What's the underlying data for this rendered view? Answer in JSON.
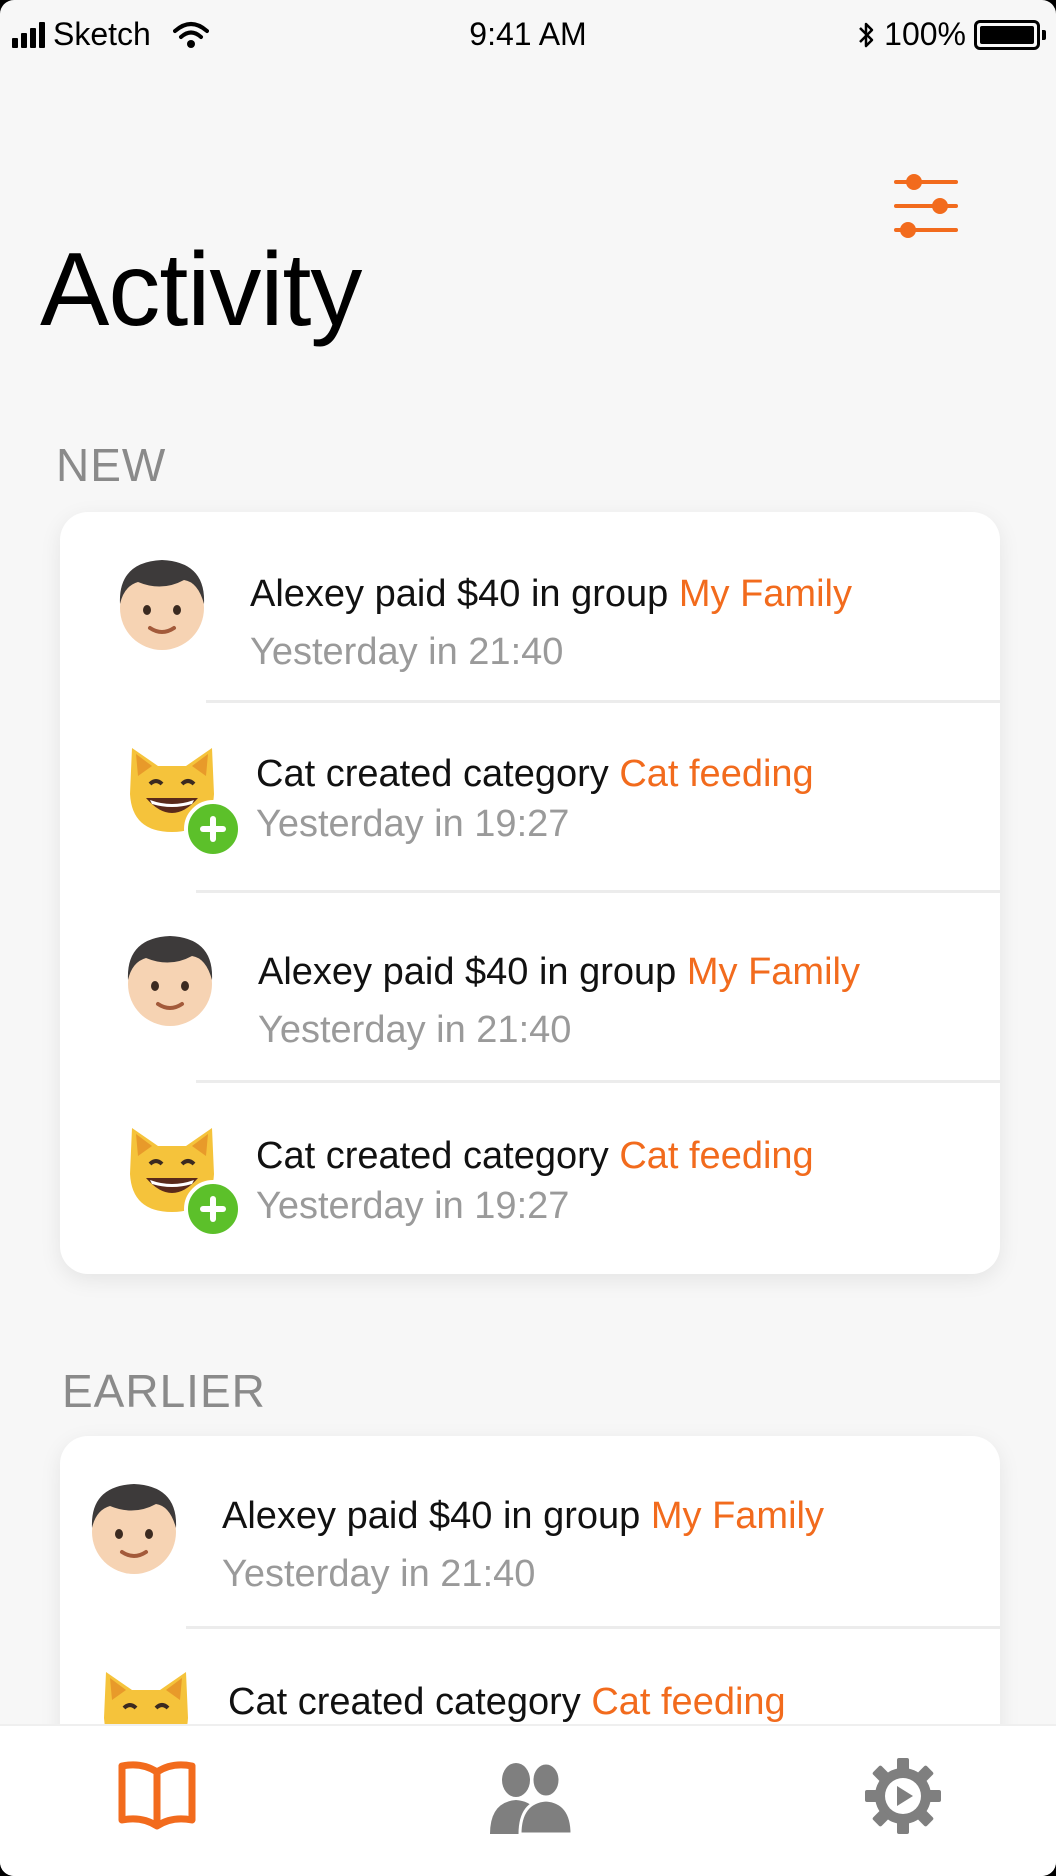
{
  "status_bar": {
    "carrier": "Sketch",
    "time": "9:41 AM",
    "battery": "100%",
    "battery_level": 1.0
  },
  "header": {
    "title": "Activity",
    "filter_icon": "sliders-icon"
  },
  "sections": [
    {
      "label": "NEW",
      "items": [
        {
          "actor_icon": "boy-face-emoji-icon",
          "text": "Alexey paid $40 in group ",
          "link": "My Family",
          "time": "Yesterday in 21:40"
        },
        {
          "actor_icon": "cat-face-emoji-icon",
          "badge_icon": "plus-circle-icon",
          "text": "Cat created category ",
          "link": "Cat feeding",
          "time": "Yesterday in 19:27"
        },
        {
          "actor_icon": "boy-face-emoji-icon",
          "text": "Alexey paid $40 in group ",
          "link": "My Family",
          "time": "Yesterday in 21:40"
        },
        {
          "actor_icon": "cat-face-emoji-icon",
          "badge_icon": "plus-circle-icon",
          "text": "Cat created category ",
          "link": "Cat feeding",
          "time": "Yesterday in 19:27"
        }
      ]
    },
    {
      "label": "EARLIER",
      "items": [
        {
          "actor_icon": "boy-face-emoji-icon",
          "text": "Alexey paid $40 in group ",
          "link": "My Family",
          "time": "Yesterday in 21:40"
        },
        {
          "actor_icon": "cat-face-emoji-icon",
          "text": "Cat created category ",
          "link": "Cat feeding",
          "time": ""
        }
      ]
    }
  ],
  "tab_bar": {
    "tabs": [
      {
        "icon": "book-icon",
        "active": true
      },
      {
        "icon": "people-icon",
        "active": false
      },
      {
        "icon": "gear-icon",
        "active": false
      }
    ]
  },
  "colors": {
    "accent": "#f26b1d",
    "inactive": "#7f7f7f",
    "badge_green": "#5cc02a",
    "background": "#f7f7f7"
  }
}
